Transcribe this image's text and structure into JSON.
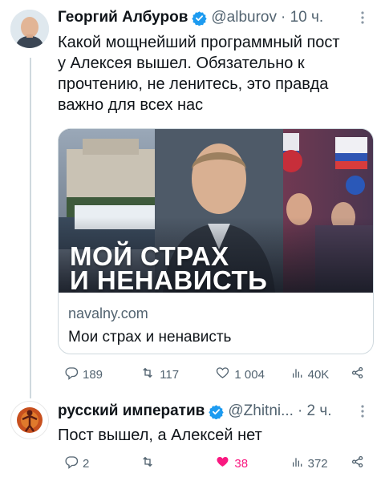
{
  "tweet1": {
    "author_name": "Георгий Албуров",
    "handle": "@alburov",
    "time": "· 10 ч.",
    "text_lines": [
      "Какой мощнейший программный пост",
      "у Алексея вышел. Обязательно к",
      "прочтению, не ленитесь, это правда",
      "важно для всех нас"
    ],
    "card": {
      "headline_line1": "МОЙ СТРАХ",
      "headline_line2": "И НЕНАВИСТЬ",
      "domain": "navalny.com",
      "title": "Мои страх и ненависть"
    },
    "actions": {
      "replies": "189",
      "reposts": "117",
      "likes": "1 004",
      "views": "40K"
    }
  },
  "tweet2": {
    "author_name": "русский императив",
    "handle": "@Zhitni...",
    "time": "· 2 ч.",
    "text": "Пост вышел, а Алексей нет",
    "actions": {
      "replies": "2",
      "reposts": "",
      "likes": "38",
      "views": "372"
    }
  },
  "icons": [
    "verified-badge-icon",
    "more-icon",
    "reply-icon",
    "repost-icon",
    "like-icon",
    "views-icon",
    "share-icon"
  ],
  "colors": {
    "verified": "#1d9bf0",
    "secondary_text": "#536471",
    "like_active": "#f91880",
    "border": "#cfd9de"
  }
}
